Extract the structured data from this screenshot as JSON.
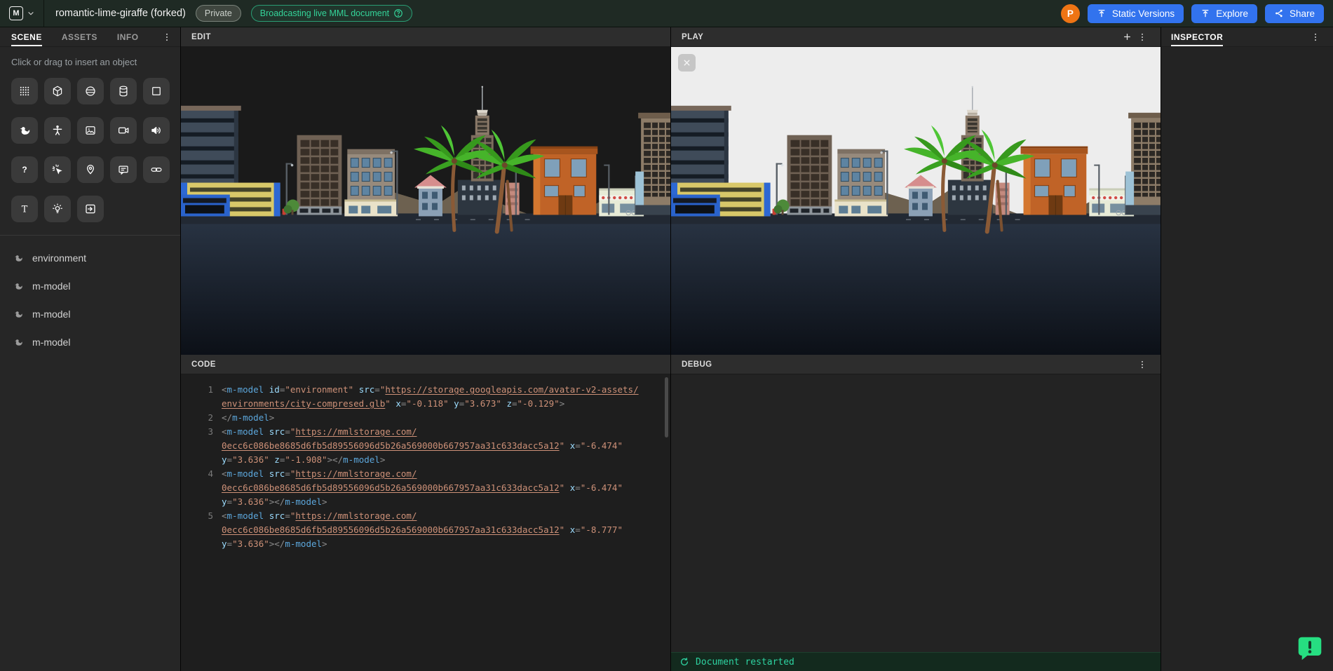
{
  "theme": {
    "accent_blue": "#3273ee",
    "accent_green": "#34d399",
    "avatar_orange": "#ee7414",
    "feedback_green": "#26de81",
    "sky_edit": "#1a1a1a",
    "sky_play": "#ededed"
  },
  "topbar": {
    "logo_letter": "M",
    "title": "romantic-lime-giraffe (forked)",
    "private_badge": "Private",
    "broadcast_badge": "Broadcasting live MML document",
    "avatar_initial": "P",
    "static_versions_label": "Static Versions",
    "explore_label": "Explore",
    "share_label": "Share"
  },
  "sidebar": {
    "tabs": [
      "SCENE",
      "ASSETS",
      "INFO"
    ],
    "active_tab": "SCENE",
    "hint": "Click or drag to insert an object",
    "insert_tools": [
      "plane",
      "cube",
      "sphere",
      "cylinder",
      "quad",
      "duck",
      "character",
      "image",
      "video",
      "audio",
      "prompt",
      "interaction",
      "position-probe",
      "chat-bubble",
      "link",
      "text",
      "light",
      "portal"
    ],
    "scene_items": [
      "environment",
      "m-model",
      "m-model",
      "m-model"
    ]
  },
  "panels": {
    "edit_title": "EDIT",
    "play_title": "PLAY",
    "code_title": "CODE",
    "debug_title": "DEBUG",
    "inspector_title": "INSPECTOR",
    "debug_status": "Document restarted"
  },
  "code_lines": [
    {
      "num": 1,
      "tokens": [
        {
          "t": "p",
          "v": "<"
        },
        {
          "t": "tag",
          "v": "m-model"
        },
        {
          "t": "sp"
        },
        {
          "t": "attr",
          "v": "id"
        },
        {
          "t": "p",
          "v": "="
        },
        {
          "t": "str",
          "v": "\"environment\""
        },
        {
          "t": "sp"
        },
        {
          "t": "attr",
          "v": "src"
        },
        {
          "t": "p",
          "v": "="
        },
        {
          "t": "str",
          "v": "\""
        },
        {
          "t": "url",
          "v": "https://storage.googleapis.com/avatar-v2-assets/"
        },
        {
          "t": "url",
          "v": "environments/city-compresed.glb",
          "wbr": true
        },
        {
          "t": "str",
          "v": "\""
        },
        {
          "t": "sp"
        },
        {
          "t": "attr",
          "v": "x"
        },
        {
          "t": "p",
          "v": "="
        },
        {
          "t": "str",
          "v": "\"-0.118\""
        },
        {
          "t": "sp"
        },
        {
          "t": "attr",
          "v": "y"
        },
        {
          "t": "p",
          "v": "="
        },
        {
          "t": "str",
          "v": "\"3.673\""
        },
        {
          "t": "sp"
        },
        {
          "t": "attr",
          "v": "z"
        },
        {
          "t": "p",
          "v": "="
        },
        {
          "t": "str",
          "v": "\"-0.129\""
        },
        {
          "t": "p",
          "v": ">"
        }
      ]
    },
    {
      "num": 2,
      "tokens": [
        {
          "t": "p",
          "v": "</"
        },
        {
          "t": "tag",
          "v": "m-model"
        },
        {
          "t": "p",
          "v": ">"
        }
      ]
    },
    {
      "num": 3,
      "tokens": [
        {
          "t": "p",
          "v": "<"
        },
        {
          "t": "tag",
          "v": "m-model"
        },
        {
          "t": "sp"
        },
        {
          "t": "attr",
          "v": "src"
        },
        {
          "t": "p",
          "v": "="
        },
        {
          "t": "str",
          "v": "\""
        },
        {
          "t": "url",
          "v": "https://mmlstorage.com/"
        },
        {
          "t": "url",
          "v": "0ecc6c086be8685d6fb5d89556096d5b26a569000b667957aa31c633dacc5a12",
          "wbr": true
        },
        {
          "t": "str",
          "v": "\""
        },
        {
          "t": "sp"
        },
        {
          "t": "attr",
          "v": "x"
        },
        {
          "t": "p",
          "v": "="
        },
        {
          "t": "str",
          "v": "\"-6.474\""
        },
        {
          "t": "sp"
        },
        {
          "t": "attr",
          "v": "y"
        },
        {
          "t": "p",
          "v": "="
        },
        {
          "t": "str",
          "v": "\"3.636\""
        },
        {
          "t": "sp"
        },
        {
          "t": "attr",
          "v": "z"
        },
        {
          "t": "p",
          "v": "="
        },
        {
          "t": "str",
          "v": "\"-1.908\""
        },
        {
          "t": "p",
          "v": ">"
        },
        {
          "t": "p",
          "v": "</"
        },
        {
          "t": "tag",
          "v": "m-model"
        },
        {
          "t": "p",
          "v": ">"
        }
      ]
    },
    {
      "num": 4,
      "tokens": [
        {
          "t": "p",
          "v": "<"
        },
        {
          "t": "tag",
          "v": "m-model"
        },
        {
          "t": "sp"
        },
        {
          "t": "attr",
          "v": "src"
        },
        {
          "t": "p",
          "v": "="
        },
        {
          "t": "str",
          "v": "\""
        },
        {
          "t": "url",
          "v": "https://mmlstorage.com/"
        },
        {
          "t": "url",
          "v": "0ecc6c086be8685d6fb5d89556096d5b26a569000b667957aa31c633dacc5a12",
          "wbr": true
        },
        {
          "t": "str",
          "v": "\""
        },
        {
          "t": "sp"
        },
        {
          "t": "attr",
          "v": "x"
        },
        {
          "t": "p",
          "v": "="
        },
        {
          "t": "str",
          "v": "\"-6.474\""
        },
        {
          "t": "sp"
        },
        {
          "t": "attr",
          "v": "y"
        },
        {
          "t": "p",
          "v": "="
        },
        {
          "t": "str",
          "v": "\"3.636\""
        },
        {
          "t": "p",
          "v": ">"
        },
        {
          "t": "p",
          "v": "</"
        },
        {
          "t": "tag",
          "v": "m-model"
        },
        {
          "t": "p",
          "v": ">"
        }
      ]
    },
    {
      "num": 5,
      "tokens": [
        {
          "t": "p",
          "v": "<"
        },
        {
          "t": "tag",
          "v": "m-model"
        },
        {
          "t": "sp"
        },
        {
          "t": "attr",
          "v": "src"
        },
        {
          "t": "p",
          "v": "="
        },
        {
          "t": "str",
          "v": "\""
        },
        {
          "t": "url",
          "v": "https://mmlstorage.com/"
        },
        {
          "t": "url",
          "v": "0ecc6c086be8685d6fb5d89556096d5b26a569000b667957aa31c633dacc5a12",
          "wbr": true
        },
        {
          "t": "str",
          "v": "\""
        },
        {
          "t": "sp"
        },
        {
          "t": "attr",
          "v": "x"
        },
        {
          "t": "p",
          "v": "="
        },
        {
          "t": "str",
          "v": "\"-8.777\""
        },
        {
          "t": "sp"
        },
        {
          "t": "attr",
          "v": "y"
        },
        {
          "t": "p",
          "v": "="
        },
        {
          "t": "str",
          "v": "\"3.636\""
        },
        {
          "t": "p",
          "v": ">"
        },
        {
          "t": "p",
          "v": "</"
        },
        {
          "t": "tag",
          "v": "m-model"
        },
        {
          "t": "p",
          "v": ">"
        }
      ]
    }
  ]
}
